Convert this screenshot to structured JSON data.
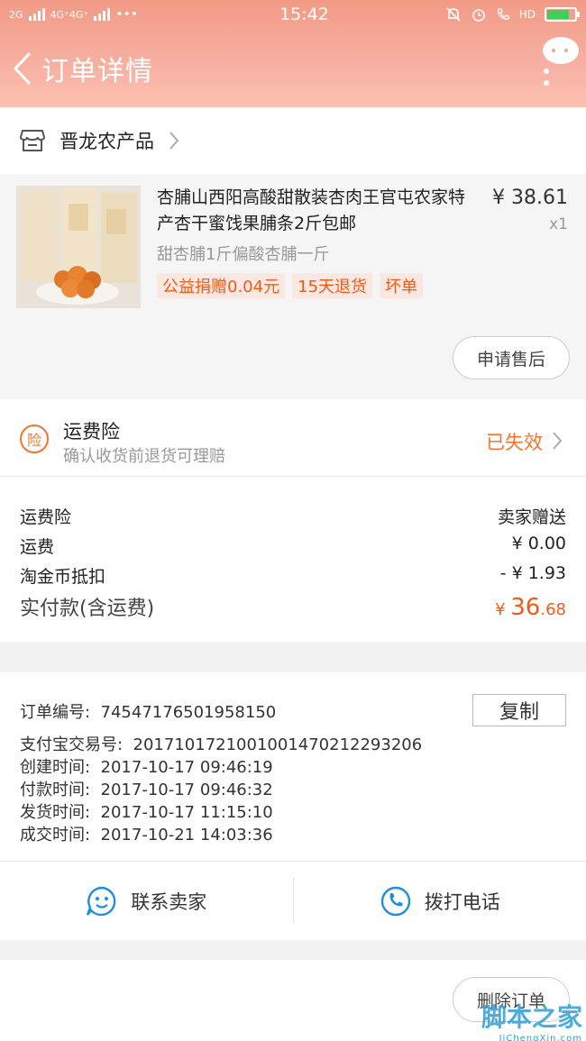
{
  "status_bar": {
    "signal_left": "2G",
    "signal_mid": "4G⁺4G⁺",
    "dots": "•••",
    "time": "15:42",
    "hd": "HD",
    "battery_level": 0.75
  },
  "header": {
    "title": "订单详情"
  },
  "shop": {
    "name": "晋龙农产品"
  },
  "item": {
    "title": "杏脯山西阳高酸甜散装杏肉王官屯农家特产杏干蜜饯果脯条2斤包邮",
    "price": "¥ 38.61",
    "quantity": "x1",
    "spec": "甜杏脯1斤偏酸杏脯一斤",
    "tags": [
      "公益捐赠0.04元",
      "15天退货",
      "坏单"
    ],
    "after_sale_label": "申请售后"
  },
  "insurance": {
    "badge": "险",
    "title": "运费险",
    "subtitle": "确认收货前退货可理赔",
    "status": "已失效"
  },
  "fees": {
    "rows": [
      {
        "label": "运费险",
        "value": "卖家赠送"
      },
      {
        "label": "运费",
        "value": "¥ 0.00"
      },
      {
        "label": "淘金币抵扣",
        "value": "- ¥ 1.93"
      }
    ],
    "total_label": "实付款(含运费)",
    "total_currency": "¥ ",
    "total_integer": "36",
    "total_decimal": ".68"
  },
  "order_info": {
    "copy_label": "复制",
    "rows": [
      {
        "label": "订单编号:",
        "value": "74547176501958150"
      },
      {
        "label": "支付宝交易号:",
        "value": "2017101721001001470212293206"
      },
      {
        "label": "创建时间:",
        "value": "2017-10-17  09:46:19"
      },
      {
        "label": "付款时间:",
        "value": "2017-10-17  09:46:32"
      },
      {
        "label": "发货时间:",
        "value": "2017-10-17  11:15:10"
      },
      {
        "label": "成交时间:",
        "value": "2017-10-21  14:03:36"
      }
    ]
  },
  "contact": {
    "seller_label": "联系卖家",
    "phone_label": "拨打电话"
  },
  "bottom": {
    "delete_label": "删除订单",
    "watermark_main": "脚本之家",
    "watermark_sub": "JiChengXin.com"
  },
  "colors": {
    "accent": "#f25a1a",
    "header_start": "#f29a86",
    "header_end": "#fbc0b2",
    "link_blue": "#1d8fe0"
  }
}
